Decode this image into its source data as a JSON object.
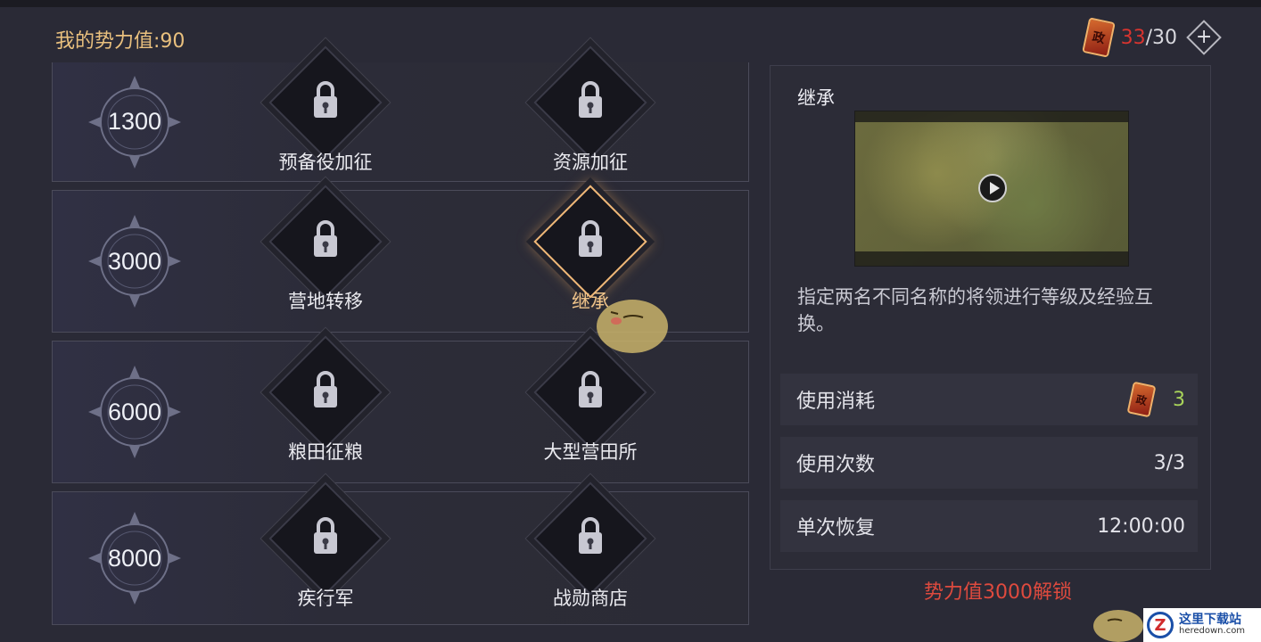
{
  "header": {
    "power_label": "我的势力值:90",
    "currency_icon_text": "政",
    "currency_current": "33",
    "currency_max": "/30",
    "plus_symbol": "+",
    "colors": {
      "power": "#e9c07e",
      "currency_current": "#d8342f"
    }
  },
  "tiers": [
    {
      "value": "1300",
      "skills": [
        {
          "label": "预备役加征",
          "icon": "lock-icon",
          "active": false
        },
        {
          "label": "资源加征",
          "icon": "lock-icon",
          "active": false
        }
      ]
    },
    {
      "value": "3000",
      "skills": [
        {
          "label": "营地转移",
          "icon": "lock-icon",
          "active": false
        },
        {
          "label": "继承",
          "icon": "lock-icon",
          "active": true
        }
      ]
    },
    {
      "value": "6000",
      "skills": [
        {
          "label": "粮田征粮",
          "icon": "lock-icon",
          "active": false
        },
        {
          "label": "大型营田所",
          "icon": "lock-icon",
          "active": false
        }
      ]
    },
    {
      "value": "8000",
      "skills": [
        {
          "label": "疾行军",
          "icon": "lock-icon",
          "active": false
        },
        {
          "label": "战勋商店",
          "icon": "lock-icon",
          "active": false
        }
      ]
    }
  ],
  "detail": {
    "title": "继承",
    "description": "指定两名不同名称的将领进行等级及经验互换。",
    "stats": [
      {
        "label": "使用消耗",
        "value": "3",
        "has_icon": true
      },
      {
        "label": "使用次数",
        "value": "3/3"
      },
      {
        "label": "单次恢复",
        "value": "12:00:00"
      }
    ],
    "unlock_text": "势力值3000解锁",
    "accent_color": "#de4a3e"
  },
  "watermark": {
    "logo": "Z",
    "cn": "这里下载站",
    "en": "heredown.com"
  }
}
